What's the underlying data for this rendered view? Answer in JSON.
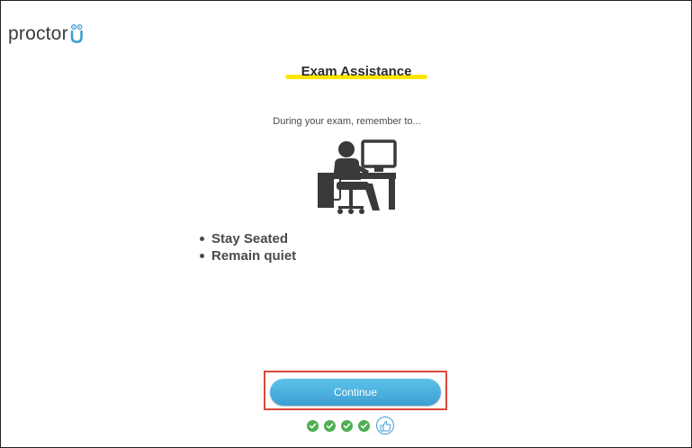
{
  "brand": {
    "logo_text": "proctor",
    "logo_u": "U",
    "accent_color": "#3d9fd2",
    "highlight_color": "#ffe600"
  },
  "page": {
    "title": "Exam Assistance",
    "subtitle": "During your exam, remember to...",
    "illustration": "person-at-desk-icon",
    "rules": [
      "Stay Seated",
      "Remain quiet"
    ]
  },
  "actions": {
    "continue_label": "Continue"
  },
  "progress": {
    "completed_steps": 4,
    "current_step_icon": "thumbs-up-icon",
    "completed_color": "#4caf50"
  }
}
